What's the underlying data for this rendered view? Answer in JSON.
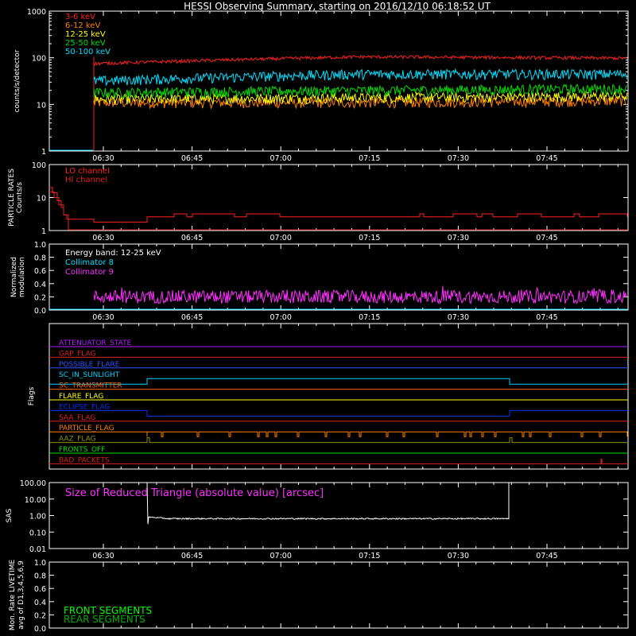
{
  "title": "HESSI Observing Summary, starting on 2016/12/10 06:18:52 UT",
  "time_ticks": [
    "06:30",
    "06:45",
    "07:00",
    "07:15",
    "07:30",
    "07:45"
  ],
  "colors": {
    "background": "#000000",
    "axis": "#ffffff",
    "ch_3_6": "#ff2020",
    "ch_6_12": "#ff8000",
    "ch_12_25": "#ffff00",
    "ch_25_50": "#00e000",
    "ch_50_100": "#00e0ff",
    "lo": "#ff2020",
    "hi": "#e02020",
    "coll8": "#00e0ff",
    "coll9": "#ff30ff",
    "sas": "#ffffff",
    "front": "#00ff00",
    "rear": "#00b000"
  },
  "chart_data": [
    {
      "type": "line",
      "panel": "counts",
      "ylabel": "counts/s/detector",
      "yscale": "log",
      "ylim": [
        1,
        1000
      ],
      "yticks": [
        "1",
        "10",
        "100",
        "1000"
      ],
      "x_unit": "UT minutes since 06:18:52",
      "xlim": [
        "06:18:52",
        "07:58:00"
      ],
      "data_start": "06:26:00",
      "series": [
        {
          "name": "3-6 keV",
          "color_key": "ch_3_6",
          "level": 105,
          "start": 75,
          "end": 98
        },
        {
          "name": "6-12 keV",
          "color_key": "ch_6_12",
          "level": 11,
          "start": 11,
          "end": 12
        },
        {
          "name": "12-25 keV",
          "color_key": "ch_12_25",
          "level": 14,
          "start": 13,
          "end": 15
        },
        {
          "name": "25-50 keV",
          "color_key": "ch_25_50",
          "level": 20,
          "start": 18,
          "end": 22
        },
        {
          "name": "50-100 keV",
          "color_key": "ch_50_100",
          "level": 45,
          "start": 32,
          "end": 45
        }
      ]
    },
    {
      "type": "line",
      "panel": "particle",
      "ylabel": [
        "PARTICLE RATES",
        "Counts/s"
      ],
      "yscale": "log",
      "ylim": [
        1,
        100
      ],
      "yticks": [
        "1",
        "10",
        "100"
      ],
      "series": [
        {
          "name": "LO channel",
          "color_key": "lo",
          "base": 2,
          "spike": 3
        },
        {
          "name": "HI channel",
          "color_key": "hi",
          "base": 1,
          "spike": 1
        }
      ]
    },
    {
      "type": "line",
      "panel": "modulation",
      "ylabel": [
        "Normalized",
        "modulation"
      ],
      "ylim": [
        0,
        1
      ],
      "yticks": [
        "0.0",
        "0.2",
        "0.4",
        "0.6",
        "0.8",
        "1.0"
      ],
      "legend_title": "Energy band: 12-25 keV",
      "series": [
        {
          "name": "Collimator 8",
          "color_key": "coll8",
          "level": 0.0
        },
        {
          "name": "Collimator 9",
          "color_key": "coll9",
          "level": 0.2
        }
      ]
    },
    {
      "type": "table",
      "panel": "flags",
      "ylabel": "Flags",
      "flags": [
        {
          "name": "ATTENUATOR_STATE",
          "color": "#b020ff"
        },
        {
          "name": "GAP_FLAG",
          "color": "#e02020"
        },
        {
          "name": "POSSIBLE_FLARE",
          "color": "#3050ff"
        },
        {
          "name": "SC_IN_SUNLIGHT",
          "color": "#00d0ff"
        },
        {
          "name": "SC_TRANSMITTER",
          "color": "#ff6000"
        },
        {
          "name": "FLARE_FLAG",
          "color": "#ffff00"
        },
        {
          "name": "ECLIPSE_FLAG",
          "color": "#0030ff"
        },
        {
          "name": "SAA_FLAG",
          "color": "#e02020"
        },
        {
          "name": "PARTICLE_FLAG",
          "color": "#ff8000"
        },
        {
          "name": "AAZ_FLAG",
          "color": "#909000"
        },
        {
          "name": "FRONTS_OFF",
          "color": "#00e000"
        },
        {
          "name": "BAD_PACKETS",
          "color": "#e02020"
        }
      ]
    },
    {
      "type": "line",
      "panel": "sas",
      "ylabel": "SAS",
      "yscale": "log",
      "ylim": [
        0.01,
        100
      ],
      "yticks": [
        "0.01",
        "0.10",
        "1.00",
        "10.00",
        "100.00"
      ],
      "series": [
        {
          "name": "Size of Reduced Triangle (absolute value) [arcsec]",
          "color_key": "sas",
          "level": 0.65,
          "spikes": [
            "06:36:00",
            "07:38:00"
          ]
        }
      ]
    },
    {
      "type": "line",
      "panel": "livetime",
      "ylabel": [
        "Mon. Rate LIVETIME",
        "avg of D1,3,4,5,6,9"
      ],
      "ylim": [
        0,
        1
      ],
      "yticks": [
        "0.0",
        "0.2",
        "0.4",
        "0.6",
        "0.8",
        "1.0"
      ],
      "series": [
        {
          "name": "FRONT SEGMENTS",
          "color_key": "front"
        },
        {
          "name": "REAR SEGMENTS",
          "color_key": "rear"
        }
      ]
    }
  ]
}
